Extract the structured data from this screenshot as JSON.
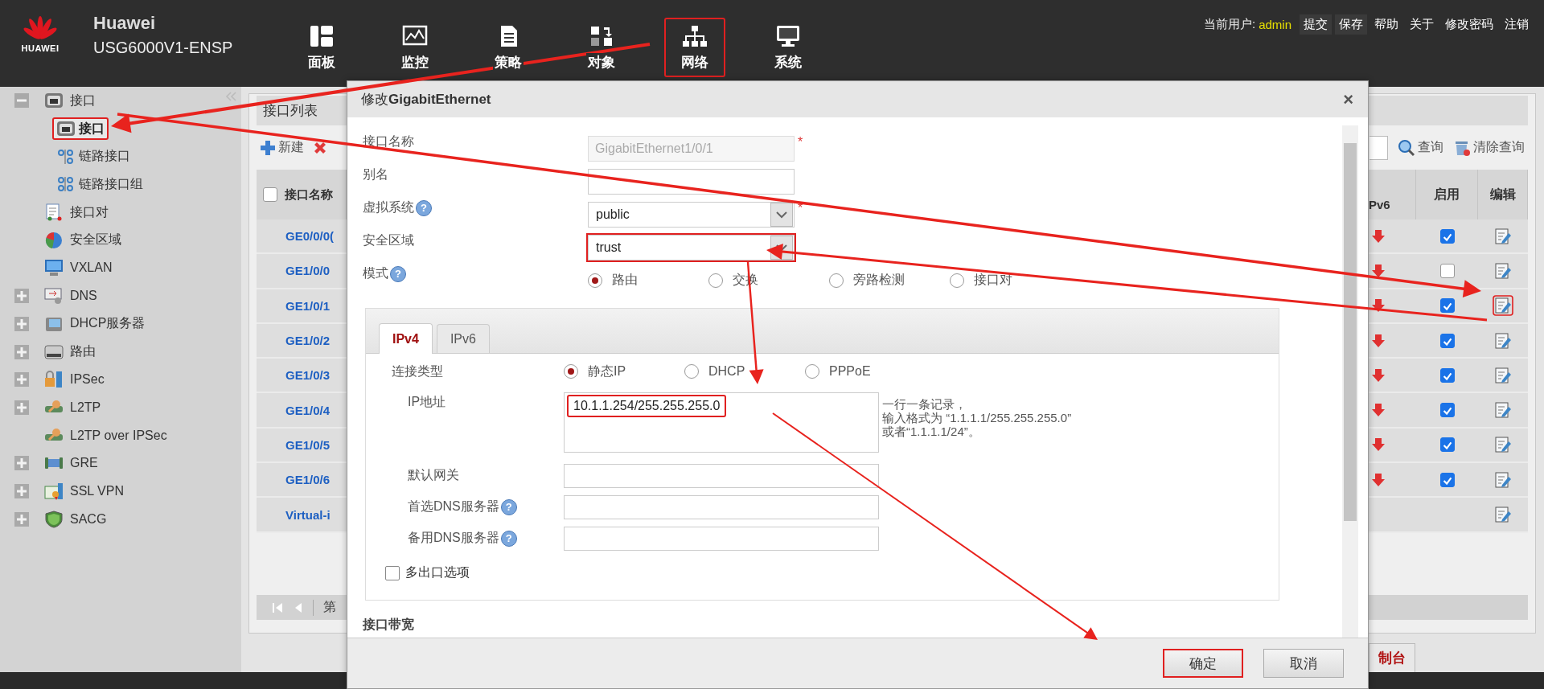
{
  "header": {
    "logo_text": "HUAWEI",
    "brand": "Huawei",
    "model": "USG6000V1-ENSP",
    "nav": [
      {
        "label": "面板",
        "highlighted": false
      },
      {
        "label": "监控",
        "highlighted": false
      },
      {
        "label": "策略",
        "highlighted": false
      },
      {
        "label": "对象",
        "highlighted": false
      },
      {
        "label": "网络",
        "highlighted": true
      },
      {
        "label": "系统",
        "highlighted": false
      }
    ],
    "user_label": "当前用户:",
    "user": "admin",
    "links": [
      "提交",
      "保存",
      "帮助",
      "关于",
      "修改密码",
      "注销"
    ]
  },
  "sidebar": {
    "items": [
      {
        "label": "接口",
        "expanded": true,
        "selected": false,
        "children": [
          {
            "label": "接口",
            "selected": true,
            "highlighted": true
          },
          {
            "label": "链路接口",
            "selected": false,
            "highlighted": false
          },
          {
            "label": "链路接口组",
            "selected": false,
            "highlighted": false
          }
        ]
      },
      {
        "label": "接口对",
        "selected": false
      },
      {
        "label": "安全区域",
        "selected": false
      },
      {
        "label": "VXLAN",
        "selected": false
      },
      {
        "label": "DNS",
        "expanded": false,
        "selected": false
      },
      {
        "label": "DHCP服务器",
        "expanded": false,
        "selected": false
      },
      {
        "label": "路由",
        "expanded": false,
        "selected": false
      },
      {
        "label": "IPSec",
        "expanded": false,
        "selected": false
      },
      {
        "label": "L2TP",
        "expanded": false,
        "selected": false
      },
      {
        "label": "L2TP over IPSec",
        "selected": false
      },
      {
        "label": "GRE",
        "expanded": false,
        "selected": false
      },
      {
        "label": "SSL VPN",
        "expanded": false,
        "selected": false
      },
      {
        "label": "SACG",
        "expanded": false,
        "selected": false
      }
    ]
  },
  "panel": {
    "title": "接口列表",
    "new_label": "新建",
    "query_label": "查询",
    "clear_label": "清除查询",
    "table": {
      "select_all_checked": false,
      "columns": {
        "name": "接口名称",
        "ipv6": "Pv6",
        "enabled": "启用",
        "edit": "编辑"
      },
      "rows": [
        {
          "name": "GE0/0/0(",
          "ipv6_down": true,
          "enabled": true,
          "highlighted": false
        },
        {
          "name": "GE1/0/0",
          "ipv6_down": true,
          "enabled": false,
          "highlighted": false
        },
        {
          "name": "GE1/0/1",
          "ipv6_down": true,
          "enabled": true,
          "highlighted": true
        },
        {
          "name": "GE1/0/2",
          "ipv6_down": true,
          "enabled": true,
          "highlighted": false
        },
        {
          "name": "GE1/0/3",
          "ipv6_down": true,
          "enabled": true,
          "highlighted": false
        },
        {
          "name": "GE1/0/4",
          "ipv6_down": true,
          "enabled": true,
          "highlighted": false
        },
        {
          "name": "GE1/0/5",
          "ipv6_down": true,
          "enabled": true,
          "highlighted": false
        },
        {
          "name": "GE1/0/6",
          "ipv6_down": true,
          "enabled": true,
          "highlighted": false
        },
        {
          "name": "Virtual-i",
          "ipv6_down": false,
          "highlighted": false
        }
      ]
    },
    "pager_label": "第",
    "bottom_tab": "制台"
  },
  "dialog": {
    "title": "修改**GigabitEthernet**",
    "close": "×",
    "fields": [
      {
        "kind": "text",
        "label": "接口名称",
        "value": "GigabitEthernet1/0/1",
        "disabled": true,
        "required_mark": "*",
        "highlighted": false
      },
      {
        "kind": "text",
        "label": "别名",
        "disabled": false,
        "highlighted": false
      },
      {
        "kind": "select",
        "label": "虚拟系统",
        "help": "?",
        "value": "public",
        "required_mark": "*",
        "highlighted": false
      },
      {
        "kind": "select",
        "label": "安全区域",
        "value": "trust",
        "highlighted": true
      },
      {
        "kind": "radio",
        "label": "模式",
        "help": "?",
        "options": [
          {
            "label": "路由",
            "selected": true
          },
          {
            "label": "交换",
            "selected": false
          },
          {
            "label": "旁路检测",
            "selected": false
          },
          {
            "label": "接口对",
            "selected": false
          }
        ]
      }
    ],
    "tabs": [
      {
        "label": "IPv4",
        "selected": true
      },
      {
        "label": "IPv6",
        "selected": false
      }
    ],
    "connection": {
      "label": "连接类型",
      "options": [
        {
          "label": "静态IP",
          "selected": true
        },
        {
          "label": "DHCP",
          "selected": false
        },
        {
          "label": "PPPoE",
          "selected": false
        }
      ]
    },
    "ip": {
      "label": "IP地址",
      "value": "10.1.1.254/255.255.255.0",
      "highlighted": true,
      "hint": [
        "一行一条记录，",
        "输入格式为 “1.1.1.1/255.255.255.0”",
        "或者“1.1.1.1/24”。"
      ]
    },
    "ip_fields": [
      {
        "label": "默认网关"
      },
      {
        "label": "首选DNS服务器",
        "help": "?"
      },
      {
        "label": "备用DNS服务器",
        "help": "?"
      }
    ],
    "multi_exit": {
      "label": "多出口选项",
      "checked": false
    },
    "bandwidth_label": "接口带宽",
    "buttons": [
      {
        "label": "确定",
        "highlighted": true
      },
      {
        "label": "取消",
        "highlighted": false
      }
    ]
  }
}
